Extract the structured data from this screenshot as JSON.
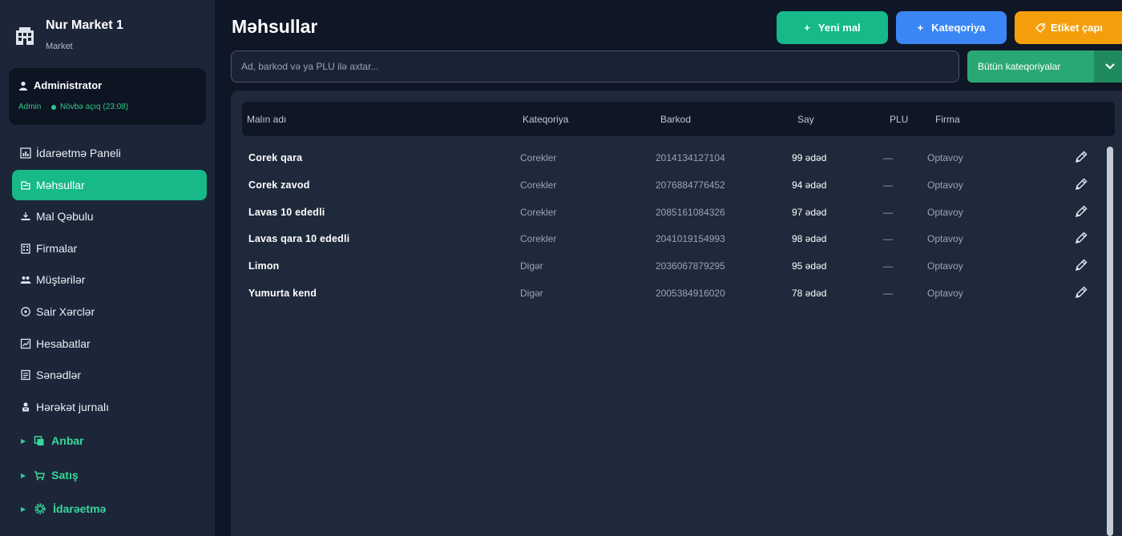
{
  "sidebar": {
    "brand_title": "Nur Market 1",
    "brand_subtitle": "Market",
    "user_name": "Administrator",
    "user_role": "Admin",
    "shift_status": "Növbə açıq (23:08)",
    "nav": [
      {
        "label": "İdarəetmə Paneli",
        "icon": "chart-icon",
        "active": false
      },
      {
        "label": "Məhsullar",
        "icon": "products-icon",
        "active": true
      },
      {
        "label": "Mal Qəbulu",
        "icon": "receiving-icon",
        "active": false
      },
      {
        "label": "Firmalar",
        "icon": "building-icon",
        "active": false
      },
      {
        "label": "Müştərilər",
        "icon": "customers-icon",
        "active": false
      },
      {
        "label": "Sair Xərclər",
        "icon": "expenses-icon",
        "active": false
      },
      {
        "label": "Hesabatlar",
        "icon": "reports-icon",
        "active": false
      },
      {
        "label": "Sənədlər",
        "icon": "documents-icon",
        "active": false
      },
      {
        "label": "Hərəkət jurnalı",
        "icon": "journal-icon",
        "active": false
      }
    ],
    "groups": [
      {
        "label": "Anbar",
        "icon": "warehouse-icon"
      },
      {
        "label": "Satış",
        "icon": "cart-icon"
      },
      {
        "label": "İdarəetmə",
        "icon": "gear-icon"
      }
    ]
  },
  "main": {
    "title": "Məhsullar",
    "buttons": {
      "new_product": "Yeni mal",
      "category": "Kateqoriya",
      "label_print": "Etiket çapı",
      "plus": "+"
    },
    "search_placeholder": "Ad, barkod və ya PLU ilə axtar...",
    "category_filter": "Bütün kateqoriyalar",
    "table": {
      "headers": {
        "name": "Malın adı",
        "category": "Kateqoriya",
        "barcode": "Barkod",
        "qty": "Say",
        "plu": "PLU",
        "firm": "Firma"
      },
      "rows": [
        {
          "name": "Corek qara",
          "category": "Corekler",
          "barcode": "2014134127104",
          "qty": "99 ədəd",
          "plu": "—",
          "firm": "Optavoy"
        },
        {
          "name": "Corek zavod",
          "category": "Corekler",
          "barcode": "2076884776452",
          "qty": "94 ədəd",
          "plu": "—",
          "firm": "Optavoy"
        },
        {
          "name": "Lavas 10 ededli",
          "category": "Corekler",
          "barcode": "2085161084326",
          "qty": "97 ədəd",
          "plu": "—",
          "firm": "Optavoy"
        },
        {
          "name": "Lavas qara 10 ededli",
          "category": "Corekler",
          "barcode": "2041019154993",
          "qty": "98 ədəd",
          "plu": "—",
          "firm": "Optavoy"
        },
        {
          "name": "Limon",
          "category": "Digər",
          "barcode": "2036067879295",
          "qty": "95 ədəd",
          "plu": "—",
          "firm": "Optavoy"
        },
        {
          "name": "Yumurta kend",
          "category": "Digər",
          "barcode": "2005384916020",
          "qty": "78 ədəd",
          "plu": "—",
          "firm": "Optavoy"
        }
      ]
    }
  },
  "colors": {
    "accent_green": "#16b987",
    "accent_blue": "#3a86f5",
    "accent_orange": "#f59e0b",
    "sidebar_bg": "#1c2638",
    "page_bg": "#0f1626"
  }
}
